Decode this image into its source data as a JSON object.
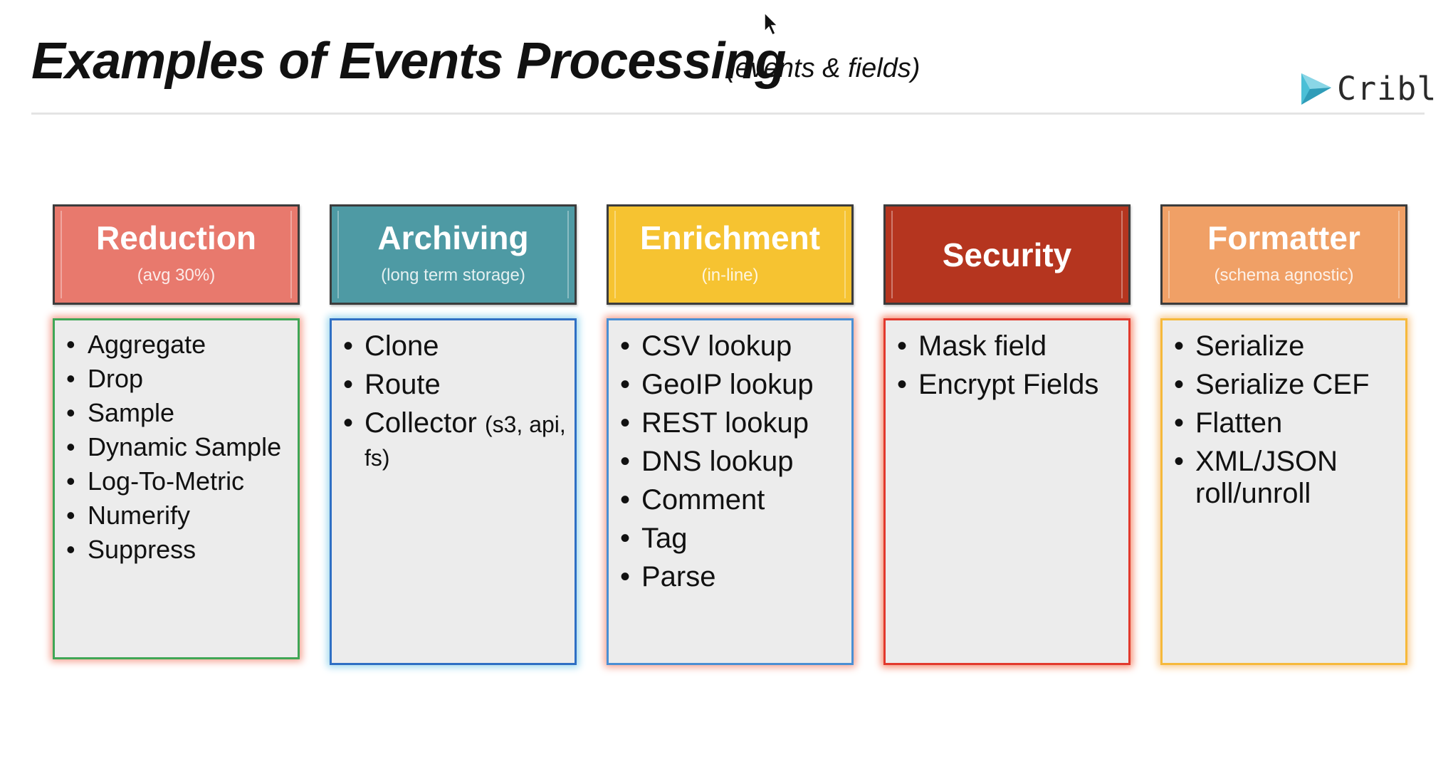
{
  "slide": {
    "title": "Examples of Events Processing",
    "subtitle": "(events & fields)"
  },
  "brand": {
    "name": "Cribl",
    "logo_icon": "cribl-chevron-logo",
    "logo_color": "#4bbfd6"
  },
  "columns": [
    {
      "title": "Reduction",
      "subtitle": "(avg 30%)",
      "header_color": "#e8796d",
      "border_color": "#3fa655",
      "glow_color": "#f4a08f",
      "items": [
        {
          "text": "Aggregate",
          "note": ""
        },
        {
          "text": "Drop",
          "note": ""
        },
        {
          "text": "Sample",
          "note": ""
        },
        {
          "text": "Dynamic Sample",
          "note": ""
        },
        {
          "text": "Log-To-Metric",
          "note": ""
        },
        {
          "text": "Numerify",
          "note": ""
        },
        {
          "text": "Suppress",
          "note": ""
        }
      ]
    },
    {
      "title": "Archiving",
      "subtitle": "(long term storage)",
      "header_color": "#4e9aa4",
      "border_color": "#2f6fc4",
      "glow_color": "#9ed8ee",
      "items": [
        {
          "text": "Clone",
          "note": ""
        },
        {
          "text": "Route",
          "note": ""
        },
        {
          "text": "Collector",
          "note": "(s3, api, fs)"
        }
      ]
    },
    {
      "title": "Enrichment",
      "subtitle": "(in-line)",
      "header_color": "#f6c331",
      "border_color": "#4a8fd4",
      "glow_color": "#f4a08f",
      "items": [
        {
          "text": "CSV lookup",
          "note": ""
        },
        {
          "text": "GeoIP lookup",
          "note": ""
        },
        {
          "text": "REST lookup",
          "note": ""
        },
        {
          "text": "DNS lookup",
          "note": ""
        },
        {
          "text": "Comment",
          "note": ""
        },
        {
          "text": "Tag",
          "note": ""
        },
        {
          "text": "Parse",
          "note": ""
        }
      ]
    },
    {
      "title": "Security",
      "subtitle": "",
      "header_color": "#b5351f",
      "border_color": "#e2392d",
      "glow_color": "#f58a6f",
      "items": [
        {
          "text": "Mask field",
          "note": ""
        },
        {
          "text": "Encrypt Fields",
          "note": ""
        }
      ]
    },
    {
      "title": "Formatter",
      "subtitle": "(schema agnostic)",
      "header_color": "#f0a066",
      "border_color": "#f6b93b",
      "glow_color": "#f8c98e",
      "items": [
        {
          "text": "Serialize",
          "note": ""
        },
        {
          "text": "Serialize CEF",
          "note": ""
        },
        {
          "text": "Flatten",
          "note": ""
        },
        {
          "text": "XML/JSON roll/unroll",
          "note": ""
        }
      ]
    }
  ]
}
